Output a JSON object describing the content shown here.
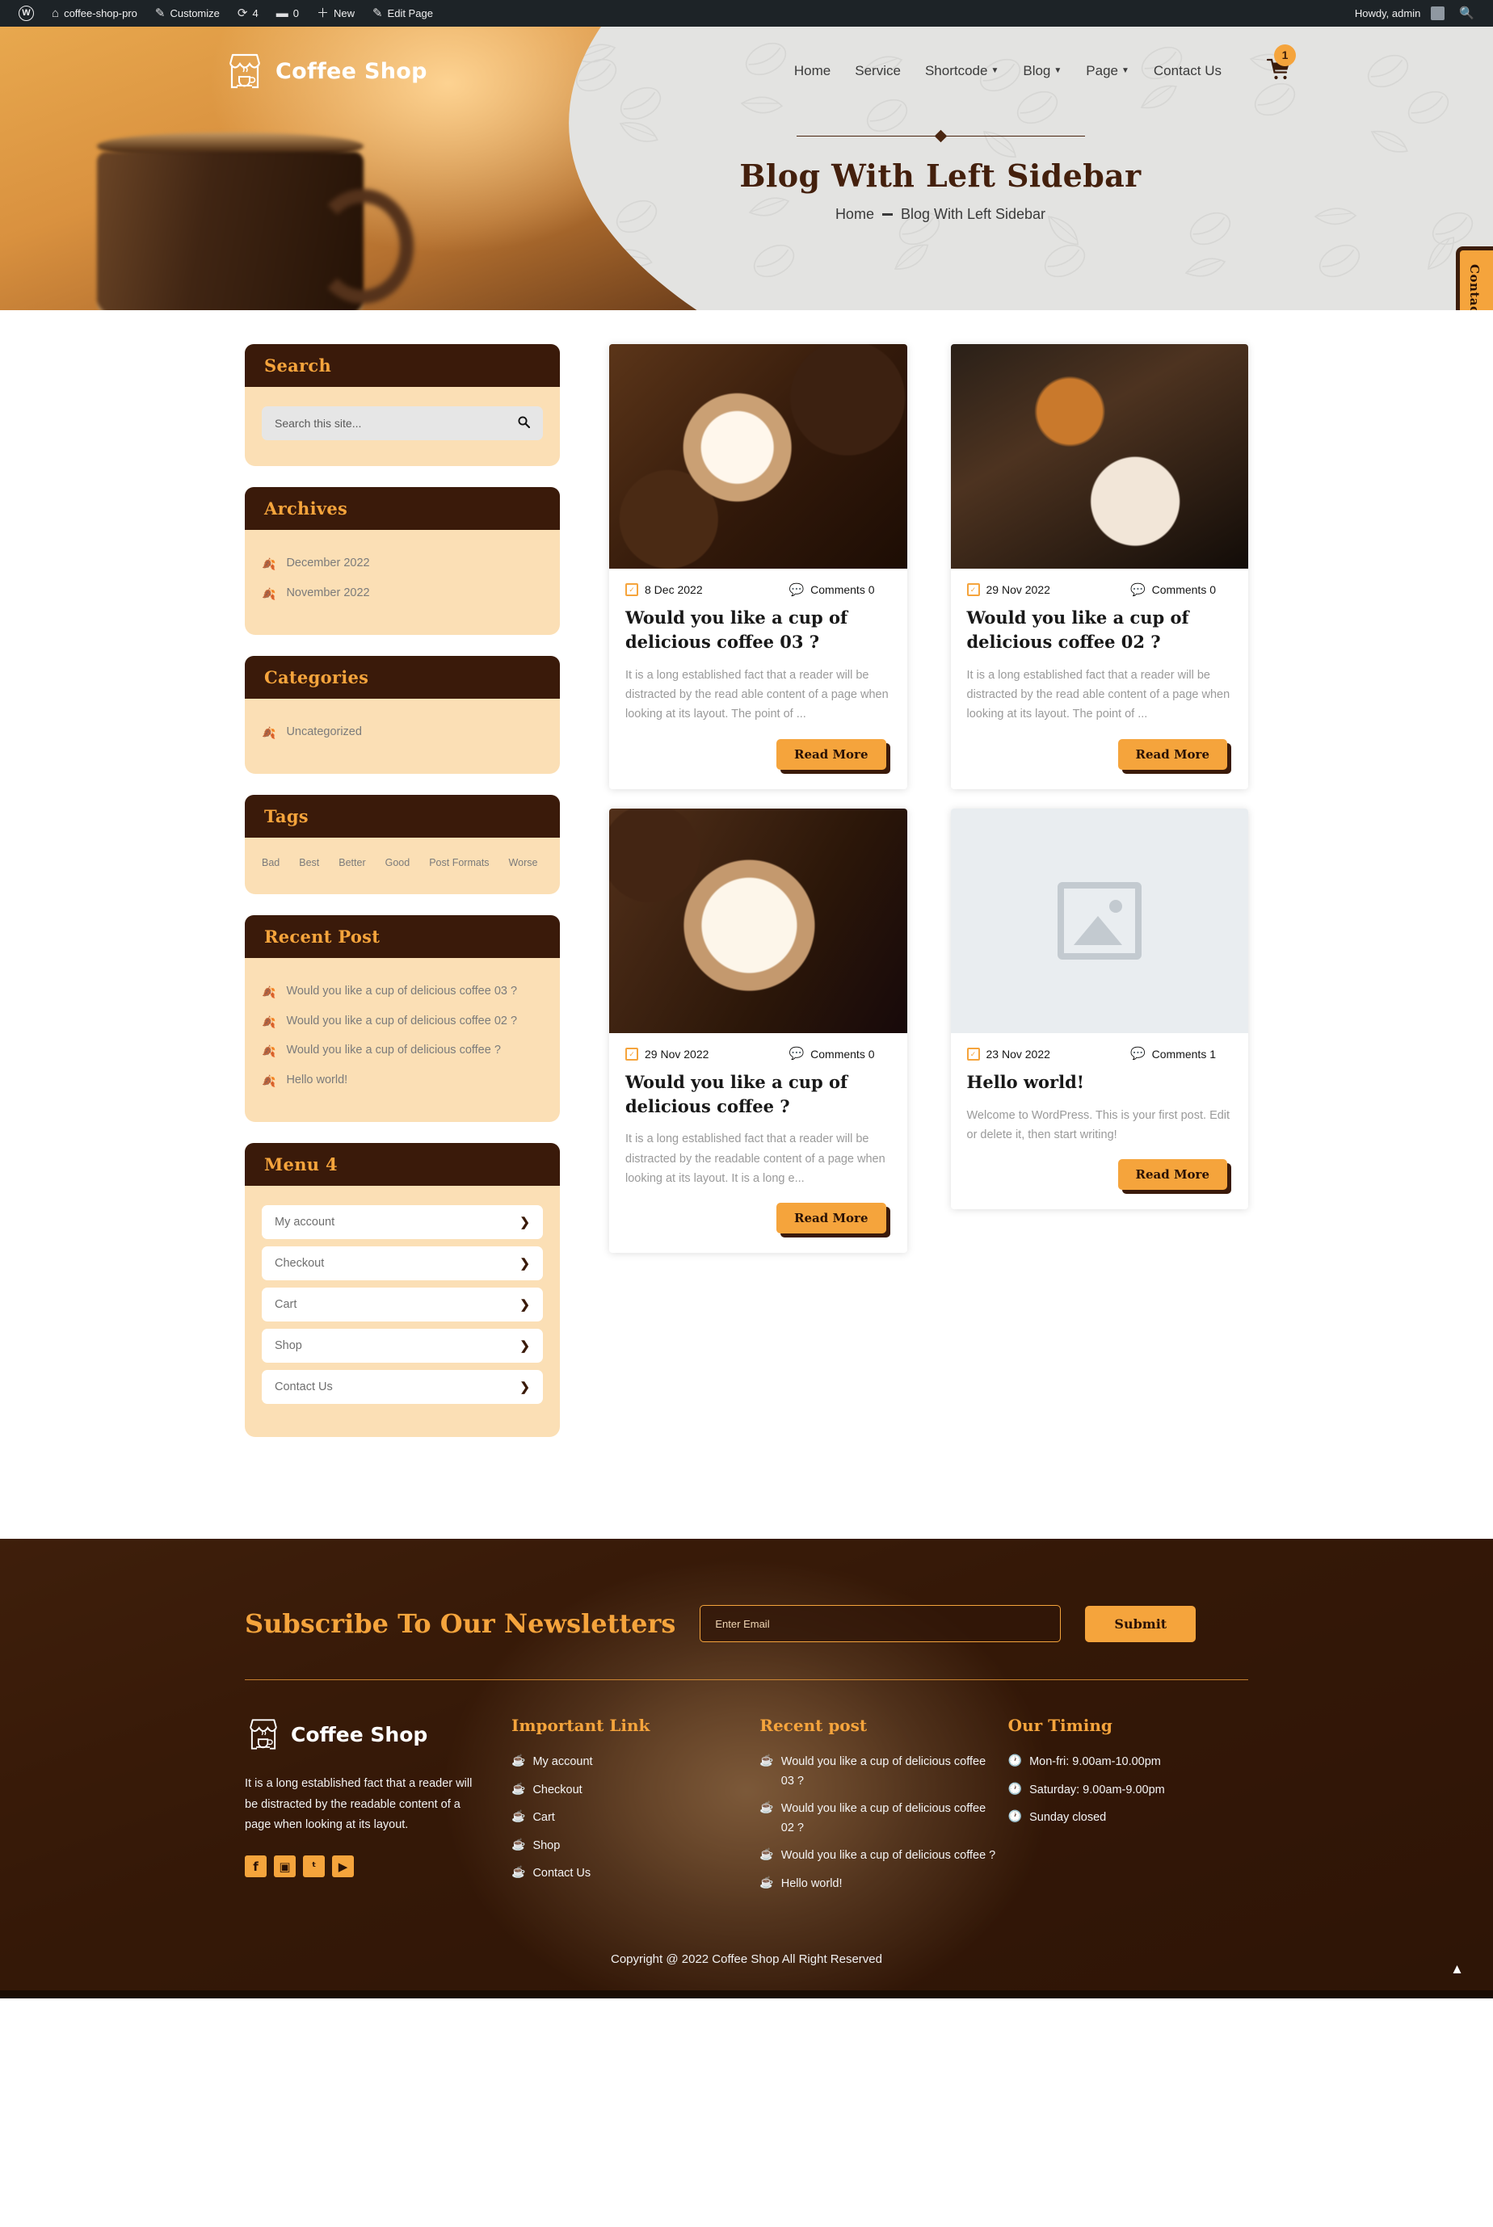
{
  "adminbar": {
    "wp_logo_icon": "wordpress-logo-icon",
    "site_name": "coffee-shop-pro",
    "site_icon": "home-icon",
    "customize": "Customize",
    "customize_icon": "pencil-icon",
    "revisions_count": "4",
    "revisions_icon": "refresh-icon",
    "comments_count": "0",
    "comments_icon": "comment-bubble-icon",
    "new": "New",
    "new_icon": "plus-icon",
    "edit_page": "Edit Page",
    "edit_icon": "pencil-icon",
    "howdy": "Howdy, admin",
    "search_icon": "search-icon"
  },
  "header": {
    "brand": "Coffee Shop",
    "brand_icon": "coffee-shop-storefront-logo",
    "nav": [
      {
        "label": "Home",
        "has_caret": false
      },
      {
        "label": "Service",
        "has_caret": false
      },
      {
        "label": "Shortcode",
        "has_caret": true
      },
      {
        "label": "Blog",
        "has_caret": true
      },
      {
        "label": "Page",
        "has_caret": true
      },
      {
        "label": "Contact Us",
        "has_caret": false
      }
    ],
    "cart_icon": "shopping-cart-icon",
    "cart_count": "1"
  },
  "hero": {
    "title": "Blog With Left Sidebar",
    "breadcrumb_home": "Home",
    "breadcrumb_current": "Blog With Left Sidebar"
  },
  "contact_tab": {
    "label": "Contact Us"
  },
  "sidebar": {
    "search": {
      "title": "Search",
      "placeholder": "Search this site...",
      "value": "",
      "button_icon": "search-icon"
    },
    "archives": {
      "title": "Archives",
      "items": [
        "December 2022",
        "November 2022"
      ]
    },
    "categories": {
      "title": "Categories",
      "items": [
        "Uncategorized"
      ]
    },
    "tags": {
      "title": "Tags",
      "items": [
        "Bad",
        "Best",
        "Better",
        "Good",
        "Post Formats",
        "Worse"
      ]
    },
    "recent_post": {
      "title": "Recent Post",
      "items": [
        "Would you like a cup of delicious coffee 03 ?",
        "Would you like a cup of delicious coffee 02 ?",
        "Would you like a cup of delicious coffee ?",
        "Hello world!"
      ]
    },
    "menu4": {
      "title": "Menu 4",
      "items": [
        "My account",
        "Checkout",
        "Cart",
        "Shop",
        "Contact Us"
      ]
    }
  },
  "posts": [
    {
      "thumb": "coffee-latte-art-beans-photo",
      "date": "8 Dec 2022",
      "comments": "Comments 0",
      "title": "Would you like a cup of delicious coffee 03 ?",
      "excerpt": "It is a long established fact that a reader will be distracted by the read able content of a page when looking at its layout. The point of ...",
      "button": "Read More"
    },
    {
      "thumb": "espresso-machine-pouring-photo",
      "date": "29 Nov 2022",
      "comments": "Comments 0",
      "title": "Would you like a cup of delicious coffee 02 ?",
      "excerpt": "It is a long established fact that a reader will be distracted by the read able content of a page when looking at its layout. The point of ...",
      "button": "Read More"
    },
    {
      "thumb": "white-cup-coffee-beans-photo",
      "date": "29 Nov 2022",
      "comments": "Comments 0",
      "title": "Would you like a cup of delicious coffee ?",
      "excerpt": "It is a long established fact that a reader will be distracted by the readable content of a page when looking at its layout. It is a long e...",
      "button": "Read More"
    },
    {
      "thumb": "image-placeholder",
      "date": "23 Nov 2022",
      "comments": "Comments 1",
      "title": "Hello world!",
      "excerpt": "Welcome to WordPress. This is your first post. Edit or delete it, then start writing!",
      "button": "Read More"
    }
  ],
  "footer": {
    "newsletter_title": "Subscribe To Our Newsletters",
    "email_placeholder": "Enter Email",
    "email_value": "",
    "submit": "Submit",
    "brand": "Coffee Shop",
    "brand_icon": "coffee-shop-storefront-logo",
    "about": "It is a long established fact that a reader will be distracted by the readable content of a page when looking at its layout.",
    "socials": [
      {
        "name": "facebook-icon",
        "glyph": "f"
      },
      {
        "name": "instagram-icon",
        "glyph": "▣"
      },
      {
        "name": "twitter-icon",
        "glyph": "ᵗ"
      },
      {
        "name": "youtube-icon",
        "glyph": "▶"
      }
    ],
    "important_link": {
      "title": "Important Link",
      "items": [
        "My account",
        "Checkout",
        "Cart",
        "Shop",
        "Contact Us"
      ]
    },
    "recent_post": {
      "title": "Recent post",
      "items": [
        "Would you like a cup of delicious coffee 03 ?",
        "Would you like a cup of delicious coffee 02 ?",
        "Would you like a cup of delicious coffee ?",
        "Hello world!"
      ]
    },
    "our_timing": {
      "title": "Our Timing",
      "items": [
        "Mon-fri: 9.00am-10.00pm",
        "Saturday: 9.00am-9.00pm",
        "Sunday closed"
      ]
    },
    "copyright": "Copyright @ 2022 Coffee Shop All Right Reserved",
    "scroll_top_icon": "chevron-up-icon"
  },
  "colors": {
    "accent": "#f5a43c",
    "dark_brown": "#3a1a0a",
    "cream": "#fbdfb5"
  }
}
